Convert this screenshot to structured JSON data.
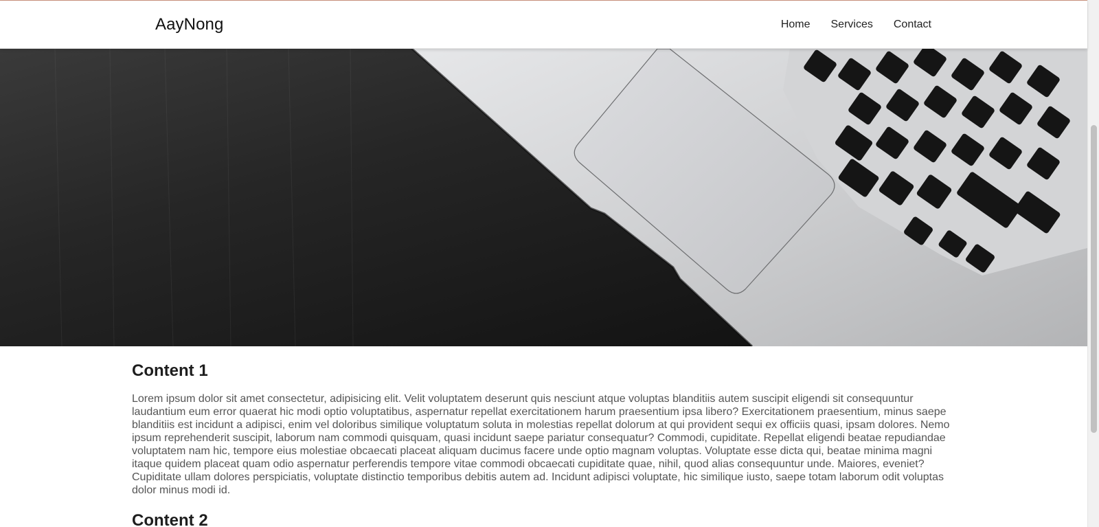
{
  "navbar": {
    "brand": "AayNong",
    "links": [
      "Home",
      "Services",
      "Contact"
    ]
  },
  "hero": {
    "image": "laptop-on-dark-wood-desk"
  },
  "sections": [
    {
      "title": "Content 1",
      "body": "Lorem ipsum dolor sit amet consectetur, adipisicing elit. Velit voluptatem deserunt quis nesciunt atque voluptas blanditiis autem suscipit eligendi sit consequuntur laudantium eum error quaerat hic modi optio voluptatibus, aspernatur repellat exercitationem harum praesentium ipsa libero? Exercitationem praesentium, minus saepe blanditiis est incidunt a adipisci, enim vel doloribus similique voluptatum soluta in molestias repellat dolorum at qui provident sequi ex officiis quasi, ipsam dolores. Nemo ipsum reprehenderit suscipit, laborum nam commodi quisquam, quasi incidunt saepe pariatur consequatur? Commodi, cupiditate. Repellat eligendi beatae repudiandae voluptatem nam hic, tempore eius molestiae obcaecati placeat aliquam ducimus facere unde optio magnam voluptas. Voluptate esse dicta qui, beatae minima magni itaque quidem placeat quam odio aspernatur perferendis tempore vitae commodi obcaecati cupiditate quae, nihil, quod alias consequuntur unde. Maiores, eveniet? Cupiditate ullam dolores perspiciatis, voluptate distinctio temporibus debitis autem ad. Incidunt adipisci voluptate, hic similique iusto, saepe totam laborum odit voluptas dolor minus modi id."
    },
    {
      "title": "Content 2"
    }
  ],
  "colors": {
    "navbar_bg": "#ffffff",
    "hero_dark": "#141414",
    "laptop_silver": "#c8c9cb",
    "text": "#555555",
    "heading": "#1e1e1e"
  }
}
